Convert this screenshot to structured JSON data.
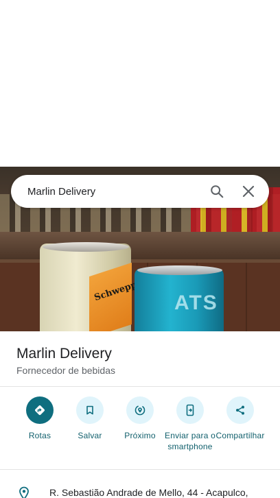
{
  "search": {
    "query": "Marlin Delivery",
    "search_icon": "search-icon",
    "close_icon": "close-icon"
  },
  "photo": {
    "can1_text": "Schweppes",
    "can2_text": "ATS"
  },
  "place": {
    "name": "Marlin Delivery",
    "category": "Fornecedor de bebidas"
  },
  "actions": [
    {
      "label": "Rotas",
      "icon": "directions-icon"
    },
    {
      "label": "Salvar",
      "icon": "bookmark-icon"
    },
    {
      "label": "Próximo",
      "icon": "nearby-icon"
    },
    {
      "label": "Enviar para o smartphone",
      "icon": "send-to-phone-icon"
    },
    {
      "label": "Compartilhar",
      "icon": "share-icon"
    }
  ],
  "address": {
    "text": "R. Sebastião Andrade de Mello, 44 - Acapulco,",
    "icon": "location-pin-icon"
  },
  "colors": {
    "primary": "#0f6e7f",
    "action_bg": "#e0f4fb",
    "action_label": "#0f5e6b"
  }
}
